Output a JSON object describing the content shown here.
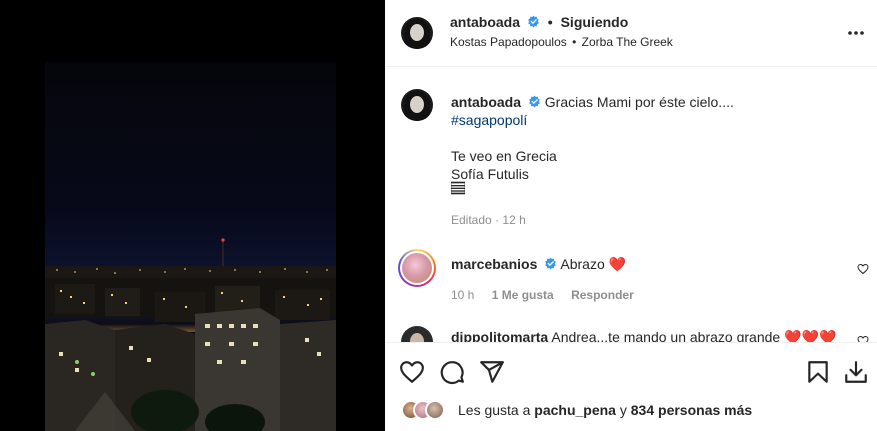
{
  "post": {
    "author": "antaboada",
    "follow_status": "Siguiendo",
    "dot": "•",
    "audio": {
      "artist": "Kostas Papadopoulos",
      "separator": "•",
      "track": "Zorba The Greek"
    },
    "more_label": "•••"
  },
  "caption": {
    "username": "antaboada",
    "line1": "Gracias Mami por éste cielo....",
    "hashtag": "#sagapopolí",
    "line2": "Te veo en Grecia",
    "line3": "Sofía Futulis",
    "flag_glyph": "𝌆",
    "edited": "Editado",
    "time": "12 h"
  },
  "comments": [
    {
      "username": "marcebanios",
      "text": "Abrazo",
      "emoji": "❤️",
      "time": "10 h",
      "likes": "1 Me gusta",
      "reply": "Responder"
    },
    {
      "username": "dippolitomarta",
      "text": "Andrea...te mando un abrazo grande",
      "emoji": "❤️❤️❤️"
    }
  ],
  "likes": {
    "prefix": "Les gusta a",
    "user": "pachu_pena",
    "conj": "y",
    "others": "834 personas más"
  },
  "colors": {
    "verified": "#3897f0",
    "link": "#00376b",
    "heart": "#ed4956",
    "muted": "#8e8e8e"
  },
  "icons": {
    "like": "heart-icon",
    "comment": "comment-icon",
    "share": "paper-plane-icon",
    "save": "bookmark-icon",
    "download": "download-icon"
  }
}
